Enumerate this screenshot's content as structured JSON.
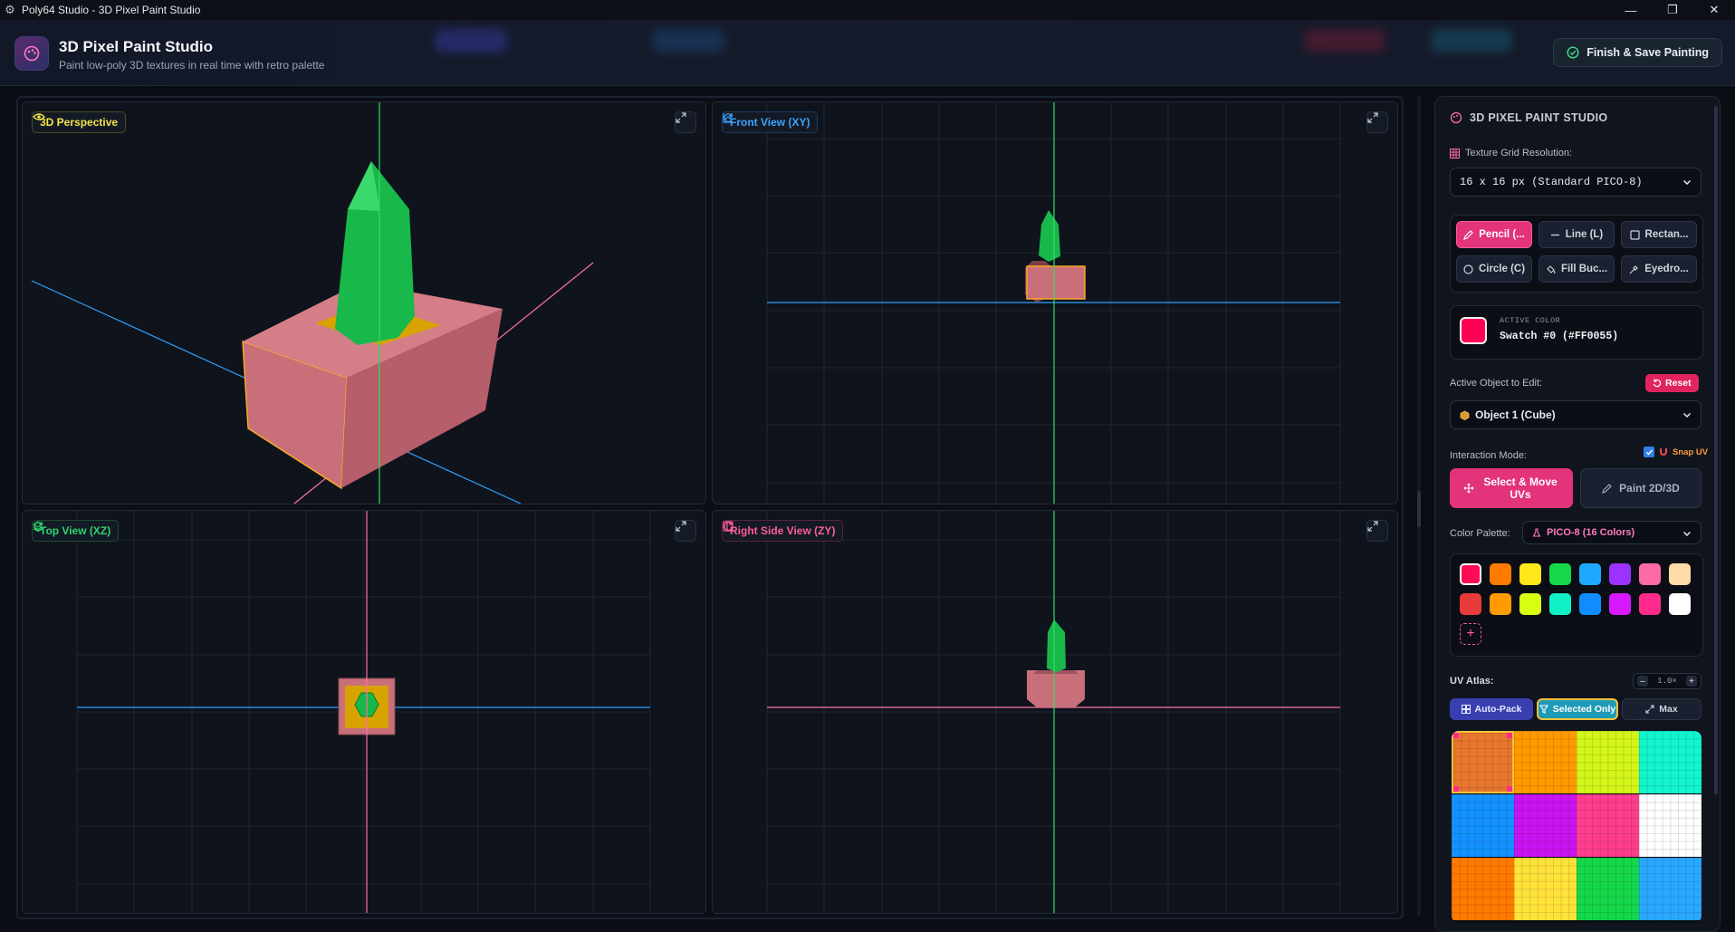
{
  "window": {
    "title": "Poly64 Studio - 3D Pixel Paint Studio"
  },
  "header": {
    "title": "3D Pixel Paint Studio",
    "subtitle": "Paint low-poly 3D textures in real time with retro palette",
    "finish_label": "Finish & Save Painting"
  },
  "viewports": {
    "perspective": {
      "label": "3D Perspective",
      "color": "#f2e14a"
    },
    "front": {
      "label": "Front View (XY)",
      "color": "#3aa4ff"
    },
    "top": {
      "label": "Top View (XZ)",
      "color": "#2ed36b"
    },
    "right": {
      "label": "Right Side View (ZY)",
      "color": "#ff5c9a"
    }
  },
  "panel": {
    "title": "3D PIXEL PAINT STUDIO",
    "grid_label": "Texture Grid Resolution:",
    "grid_value": "16 x 16 px (Standard PICO-8)",
    "tools": [
      {
        "label": "Pencil (...",
        "icon": "pencil-icon",
        "active": true
      },
      {
        "label": "Line (L)",
        "icon": "line-icon",
        "active": false
      },
      {
        "label": "Rectan...",
        "icon": "rectangle-icon",
        "active": false
      },
      {
        "label": "Circle (C)",
        "icon": "circle-icon",
        "active": false
      },
      {
        "label": "Fill Buc...",
        "icon": "fill-bucket-icon",
        "active": false
      },
      {
        "label": "Eyedro...",
        "icon": "eyedropper-icon",
        "active": false
      }
    ],
    "active_color_caption": "ACTIVE COLOR",
    "active_color_value": "Swatch #0 (#FF0055)",
    "active_color_hex": "#FF0055",
    "object_label": "Active Object to Edit:",
    "reset_label": "Reset",
    "object_value": "Object 1 (Cube)",
    "interaction_label": "Interaction Mode:",
    "snap_label": "Snap UV",
    "mode_select_label": "Select & Move UVs",
    "mode_paint_label": "Paint 2D/3D",
    "palette_label": "Color Palette:",
    "palette_value": "PICO-8 (16 Colors)",
    "swatches": [
      "#ff0a54",
      "#ff7b00",
      "#ffe81a",
      "#14d84a",
      "#1ea9ff",
      "#9b32ff",
      "#ff6aa8",
      "#ffdba8",
      "#e83a3a",
      "#ff9a00",
      "#d8ff12",
      "#12f0c8",
      "#0f8cff",
      "#d818ff",
      "#ff2a8c",
      "#ffffff"
    ],
    "uv_label": "UV Atlas:",
    "zoom_value": "1.0×",
    "autopack_label": "Auto-Pack",
    "selected_only_label": "Selected Only",
    "max_label": "Max",
    "atlas_colors": [
      "#e9762f",
      "#ff9a00",
      "#d4f51a",
      "#12f5cf",
      "#1492ff",
      "#c814f0",
      "#ff3d8f",
      "#ffffff",
      "#ff7a00",
      "#ffe23a",
      "#14d84a",
      "#2aa8ff"
    ]
  }
}
